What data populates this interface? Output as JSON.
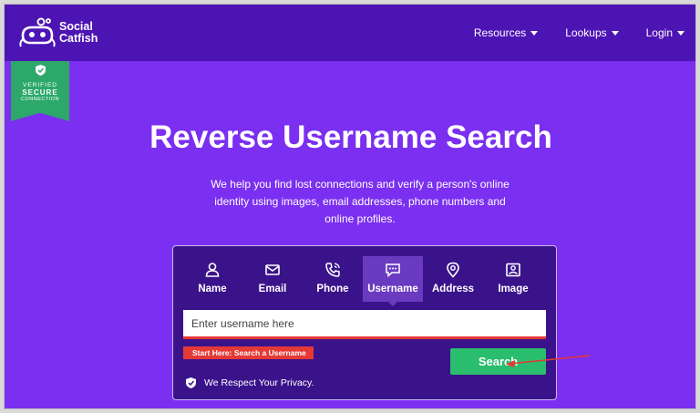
{
  "brand": {
    "line1": "Social",
    "line2": "Catfish"
  },
  "nav": [
    {
      "label": "Resources"
    },
    {
      "label": "Lookups"
    },
    {
      "label": "Login"
    }
  ],
  "badge": {
    "line1": "VERIFIED",
    "line2": "SECURE",
    "line3": "CONNECTION"
  },
  "hero": {
    "title": "Reverse Username Search",
    "subtitle": "We help you find lost connections and verify a person's online identity using images, email addresses, phone numbers and online profiles."
  },
  "search": {
    "tabs": [
      {
        "label": "Name",
        "icon": "person-icon"
      },
      {
        "label": "Email",
        "icon": "envelope-icon"
      },
      {
        "label": "Phone",
        "icon": "phone-icon"
      },
      {
        "label": "Username",
        "icon": "chat-icon",
        "active": true
      },
      {
        "label": "Address",
        "icon": "location-pin-icon"
      },
      {
        "label": "Image",
        "icon": "image-icon"
      }
    ],
    "placeholder": "Enter username here",
    "value": "",
    "hint": "Start Here: Search a Username",
    "button_label": "Search",
    "privacy": "We Respect Your Privacy."
  },
  "colors": {
    "background": "#7b2ff0",
    "topbar": "#4d14b4",
    "panel": "#3a138a",
    "active_tab": "#6a3bc0",
    "accent_green": "#2bbd6e",
    "badge_green": "#2ca86a",
    "annotation_red": "#e53935"
  }
}
